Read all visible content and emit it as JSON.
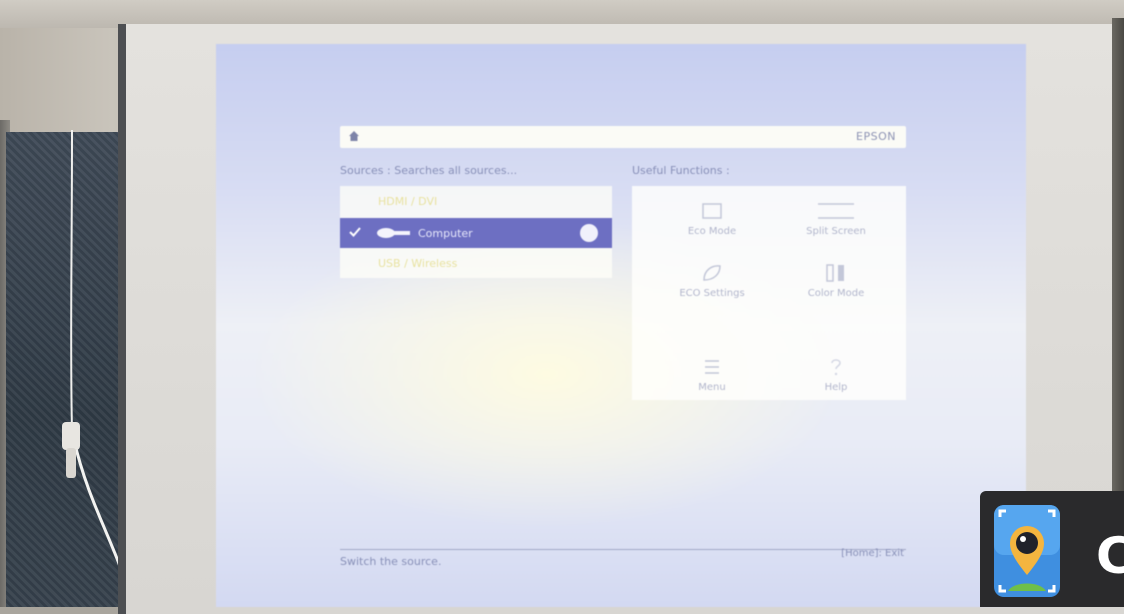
{
  "title_bar": {
    "brand": "EPSON"
  },
  "sources": {
    "label": "Sources : Searches all sources...",
    "items": [
      {
        "label": "HDMI / DVI"
      },
      {
        "label": "Computer"
      },
      {
        "label": "USB / Wireless"
      }
    ]
  },
  "functions": {
    "label": "Useful Functions :",
    "items": [
      {
        "label": "Eco Mode"
      },
      {
        "label": "Split Screen"
      },
      {
        "label": "ECO Settings"
      },
      {
        "label": "Color Mode"
      },
      {
        "label": "Menu"
      },
      {
        "label": "Help"
      }
    ]
  },
  "footer": {
    "hint": "Switch the source.",
    "right": "[Home]: Exit"
  },
  "watermark": {
    "letter": "C"
  },
  "colors": {
    "selected": "#6d6fc2",
    "projection": "#d7dcf3",
    "panel": "#fbfbf6"
  }
}
